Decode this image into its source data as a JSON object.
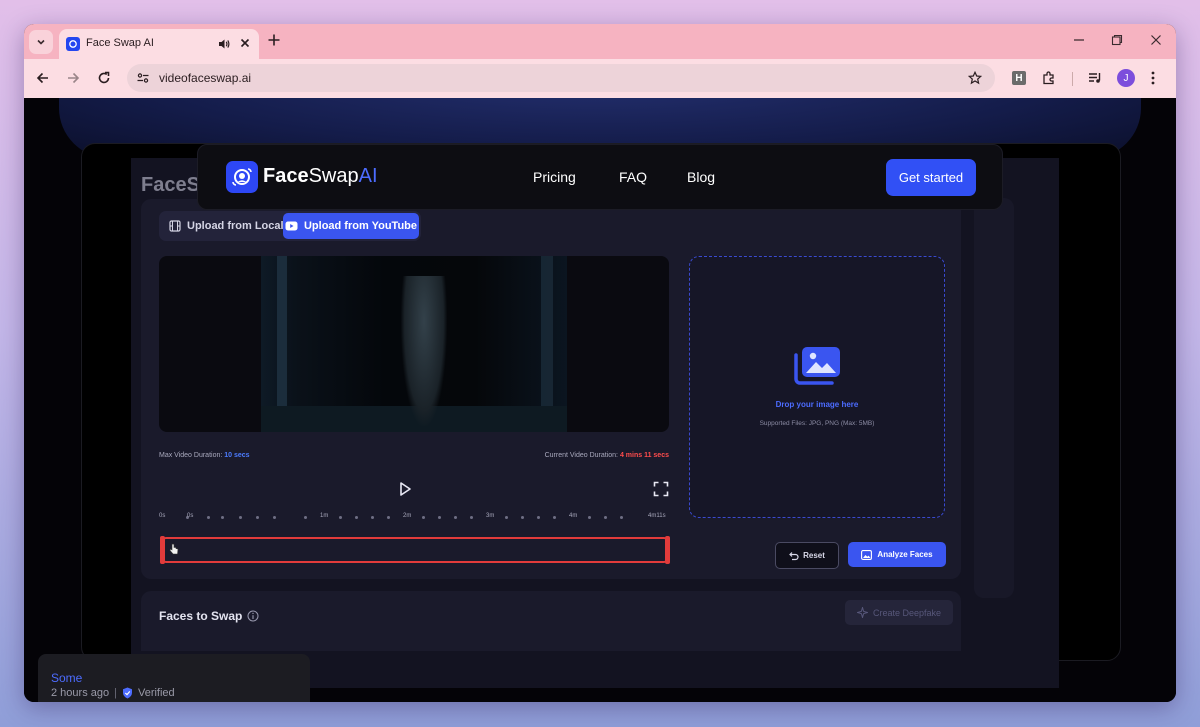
{
  "browser": {
    "tab_title": "Face Swap AI",
    "url": "videofaceswap.ai",
    "extension_label": "H",
    "profile_initial": "J"
  },
  "site_nav": {
    "logo_face": "Face",
    "logo_swap": "Swap",
    "logo_ai": "AI",
    "links": [
      "Pricing",
      "FAQ",
      "Blog"
    ],
    "cta": "Get started"
  },
  "video_app": {
    "header_logo": "FaceSwapAI",
    "source_tabs": {
      "local": "Upload from Local",
      "youtube": "Upload from YouTube"
    },
    "max_duration_label": "Max Video Duration:",
    "max_duration_value": "10 secs",
    "current_duration_label": "Current Video Duration:",
    "current_duration_value": "4 mins 11 secs",
    "ruler_labels": [
      "0s",
      "0s",
      "1m",
      "2m",
      "3m",
      "4m",
      "4m11s"
    ],
    "drop_title": "Drop your image here",
    "drop_subtitle": "Supported Files: JPG, PNG (Max: 5MB)",
    "reset_label": "Reset",
    "analyze_label": "Analyze Faces",
    "faces_title": "Faces to Swap",
    "create_label": "Create Deepfake"
  },
  "review": {
    "name": "Some",
    "time": "2 hours ago",
    "verified": "Verified"
  },
  "colors": {
    "accent": "#3150f5",
    "tabbar": "#f6b3c1",
    "toolbar": "#fcdde3",
    "trim_red": "#e23b3b"
  }
}
